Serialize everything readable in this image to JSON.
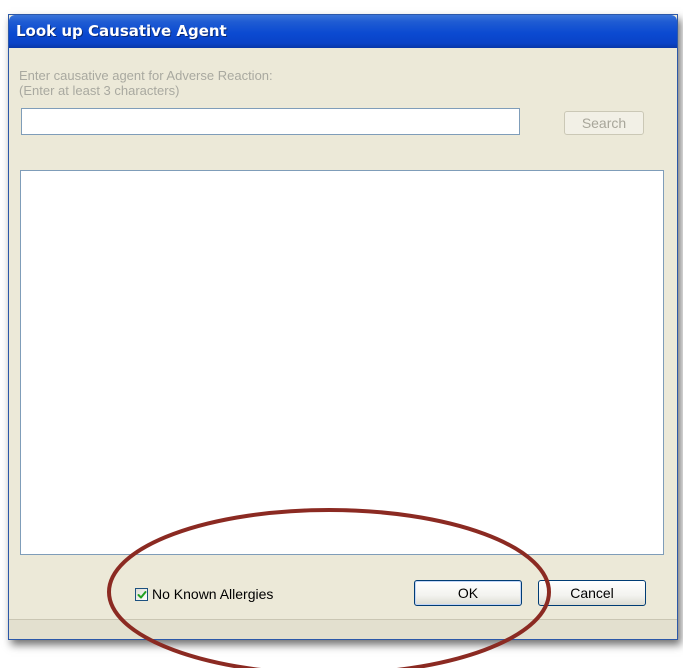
{
  "window": {
    "title": "Look up Causative Agent"
  },
  "search": {
    "prompt_line1": "Enter causative agent for Adverse Reaction:",
    "prompt_line2": "(Enter at least 3 characters)",
    "value": "",
    "placeholder": "",
    "button_label": "Search"
  },
  "results": {
    "items": []
  },
  "footer": {
    "no_known_allergies_label": "No Known Allergies",
    "no_known_allergies_checked": true,
    "ok_label": "OK",
    "cancel_label": "Cancel"
  },
  "colors": {
    "titlebar": "#0b4ad1",
    "dialog_background": "#ece9d8",
    "annotation_ellipse": "#8b2a22"
  }
}
